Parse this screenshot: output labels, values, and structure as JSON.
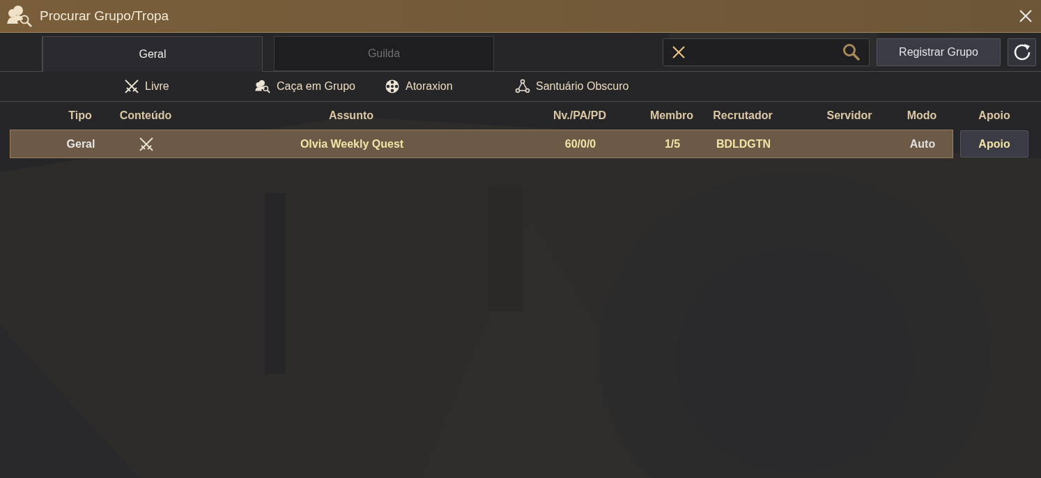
{
  "window": {
    "title": "Procurar Grupo/Tropa"
  },
  "tabs": [
    {
      "label": "Geral",
      "selected": true
    },
    {
      "label": "Guilda",
      "selected": false
    }
  ],
  "register_button": "Registrar Grupo",
  "filters": [
    {
      "label": "Livre",
      "kind": "swords"
    },
    {
      "label": "Caça em Grupo",
      "kind": "party"
    },
    {
      "label": "Atoraxion",
      "kind": "orb"
    },
    {
      "label": "Santuário Obscuro",
      "kind": "nodes"
    }
  ],
  "table": {
    "columns": [
      "Tipo",
      "Conteúdo",
      "Assunto",
      "Nv./PA/PD",
      "Membro",
      "Recrutador",
      "Servidor",
      "Modo",
      "Apoio"
    ],
    "rows": [
      {
        "type": "Geral",
        "content": {
          "kind": "swords"
        },
        "subject": "Olvia Weekly Quest",
        "level_ap_dp": "60/0/0",
        "members": "1/5",
        "recruiter": "BDLDGTN",
        "mode": "Auto",
        "action": "Apoio"
      }
    ]
  }
}
